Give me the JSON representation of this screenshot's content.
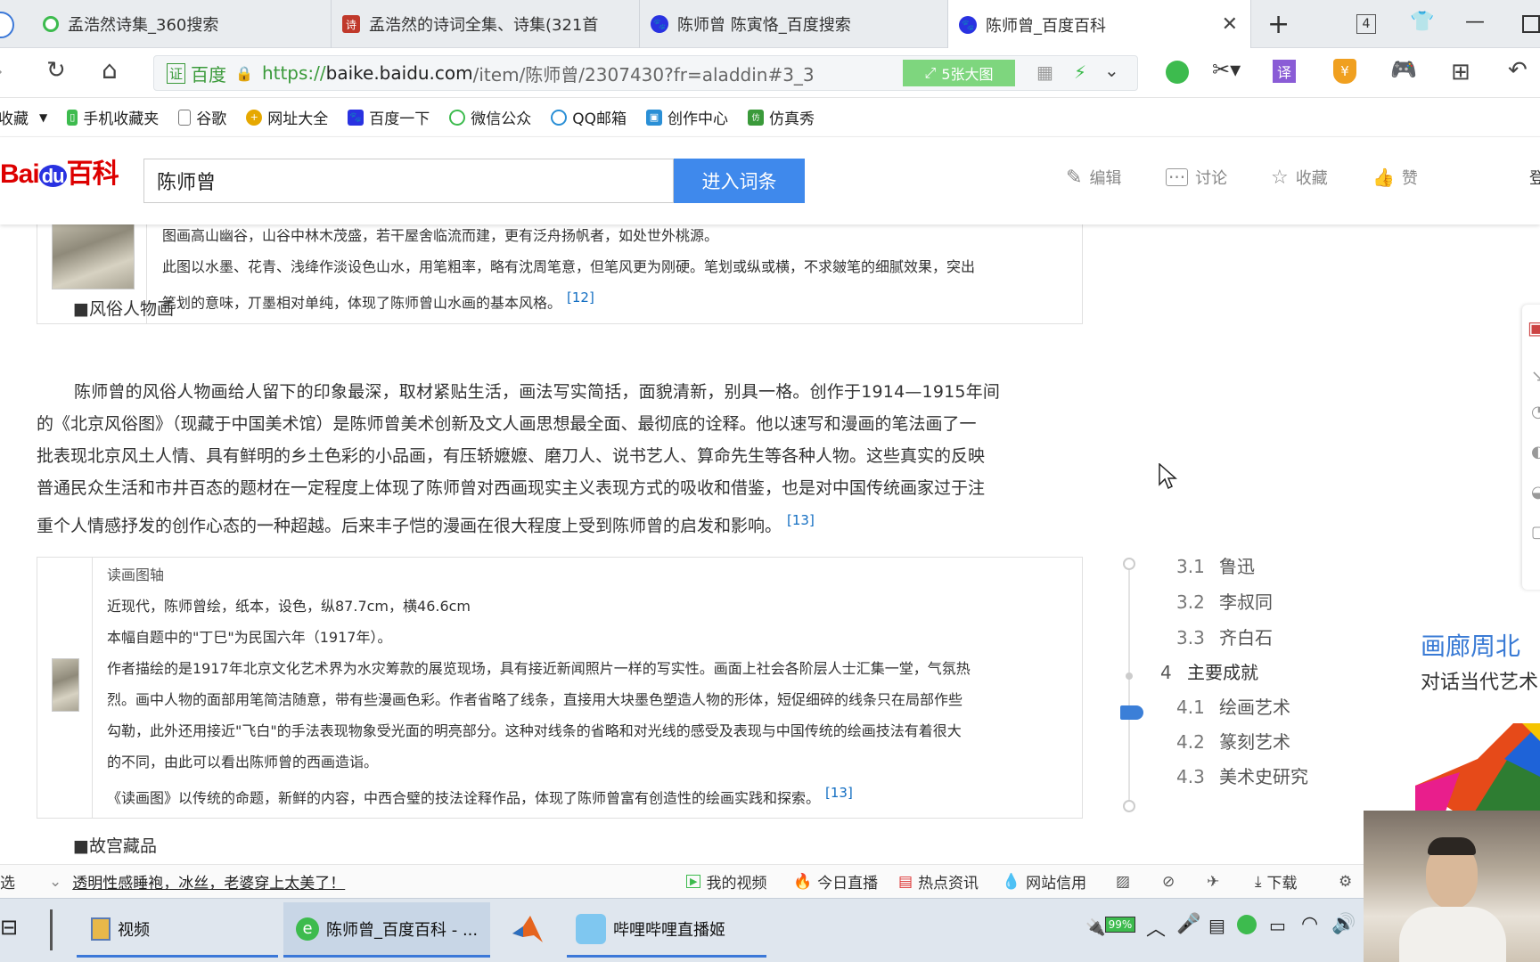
{
  "tabs": [
    {
      "label": "孟浩然诗集_360搜索",
      "icon": "search-360-icon"
    },
    {
      "label": "孟浩然的诗词全集、诗集(321首",
      "icon": "poem-site-icon"
    },
    {
      "label": "陈师曾 陈寅恪_百度搜索",
      "icon": "baidu-paw-icon"
    },
    {
      "label": "陈师曾_百度百科",
      "icon": "baidu-paw-icon",
      "active": true
    }
  ],
  "tab_count": "4",
  "address": {
    "cert": "证",
    "site": "百度",
    "url_scheme": "https://",
    "url_host": "baike.baidu.com",
    "url_path": "/item/陈师曾/2307430?fr=aladdin#3_3",
    "image_badge": "5张大图"
  },
  "bookmarks": [
    "收藏",
    "手机收藏夹",
    "谷歌",
    "网址大全",
    "百度一下",
    "微信公众",
    "QQ邮箱",
    "创作中心",
    "仿真秀"
  ],
  "baike": {
    "logo": "Bai du 百科",
    "search_value": "陈师曾",
    "enter_button": "进入词条",
    "actions": [
      "编辑",
      "讨论",
      "收藏",
      "赞"
    ],
    "login": "登"
  },
  "content": {
    "box1_line1": "图画高山幽谷，山谷中林木茂盛，若干屋舍临流而建，更有泛舟扬帆者，如处世外桃源。",
    "box1_line2": "此图以水墨、花青、浅绛作淡设色山水，用笔粗率，略有沈周笔意，但笔风更为刚硬。笔划或纵或横，不求皴笔的细腻效果，突出",
    "box1_line3": "笔划的意味，丌墨相对单纯，体现了陈师曾山水画的基本风格。",
    "box1_ref": "[12]",
    "section1": "■风俗人物画",
    "para1": [
      "陈师曾的风俗人物画给人留下的印象最深，取材紧贴生活，画法写实简括，面貌清新，别具一格。创作于1914—1915年间",
      "的《北京风俗图》（现藏于中国美术馆）是陈师曾美术创新及文人画思想最全面、最彻底的诠释。他以速写和漫画的笔法画了一",
      "批表现北京风土人情、具有鲜明的乡土色彩的小品画，有压轿嬷嬷、磨刀人、说书艺人、算命先生等各种人物。这些真实的反映",
      "普通民众生活和市井百态的题材在一定程度上体现了陈师曾对西画现实主义表现方式的吸收和借鉴，也是对中国传统画家过于注",
      "重个人情感抒发的创作心态的一种超越。后来丰子恺的漫画在很大程度上受到陈师曾的启发和影响。"
    ],
    "para1_ref": "[13]",
    "box2_title": "读画图轴",
    "box2_lines": [
      "近现代，陈师曾绘，纸本，设色，纵87.7cm，横46.6cm",
      "本幅自题中的\"丁巳\"为民国六年（1917年）。",
      "作者描绘的是1917年北京文化艺术界为水灾筹款的展览现场，具有接近新闻照片一样的写实性。画面上社会各阶层人士汇集一堂，气氛热",
      "烈。画中人物的面部用笔简洁随意，带有些漫画色彩。作者省略了线条，直接用大块墨色塑造人物的形体，短促细碎的线条只在局部作些",
      "勾勒，此外还用接近\"飞白\"的手法表现物象受光面的明亮部分。这种对线条的省略和对光线的感受及表现与中国传统的绘画技法有着很大",
      "的不同，由此可以看出陈师曾的西画造诣。",
      "《读画图》以传统的命题，新鲜的内容，中西合璧的技法诠释作品，体现了陈师曾富有创造性的绘画实践和探索。"
    ],
    "box2_ref": "[13]",
    "section2": "■故宫藏品"
  },
  "toc": [
    {
      "num": "3.1",
      "label": "鲁迅"
    },
    {
      "num": "3.2",
      "label": "李叔同"
    },
    {
      "num": "3.3",
      "label": "齐白石"
    },
    {
      "num": "4",
      "label": "主要成就"
    },
    {
      "num": "4.1",
      "label": "绘画艺术"
    },
    {
      "num": "4.2",
      "label": "篆刻艺术"
    },
    {
      "num": "4.3",
      "label": "美术史研究"
    }
  ],
  "ad": {
    "line1": "画廊周北",
    "line2": "对话当代艺术"
  },
  "statusbar": {
    "left": "选",
    "news": "透明性感睡袍，冰丝，老婆穿上太美了！",
    "items": [
      "我的视频",
      "今日直播",
      "热点资讯",
      "网站信用",
      "下载"
    ]
  },
  "taskbar": {
    "apps": [
      "视频",
      "陈师曾_百度百科 - ...",
      "",
      "哔哩哔哩直播姬"
    ],
    "battery": "99%"
  },
  "colors": {
    "accent": "#3f89ec",
    "baidu_red": "#dd0000",
    "link": "#136ec2",
    "toc_marker": "#3b7fd8"
  }
}
